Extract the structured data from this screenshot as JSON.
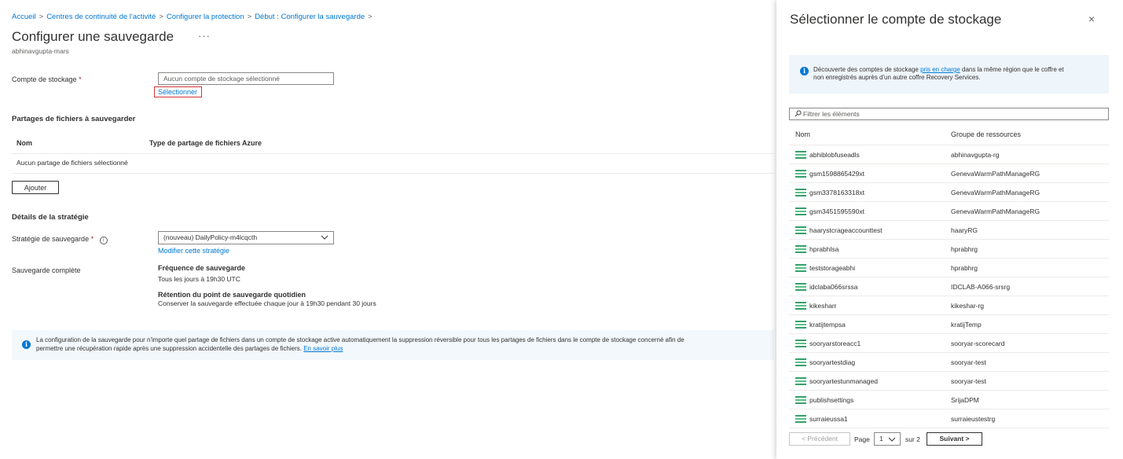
{
  "breadcrumb": {
    "items": [
      "Accueil",
      "Centres de continuité de l'activité",
      "Configurer la protection",
      "Début : Configurer la sauvegarde"
    ],
    "separator": ">"
  },
  "page": {
    "title": "Configurer une sauvegarde",
    "more": "···",
    "subtitle": "abhinavgupta-mars"
  },
  "storage": {
    "label": "Compte de stockage",
    "required": "*",
    "value": "Aucun compte de stockage sélectionné",
    "select_link": "Sélectionner"
  },
  "shares": {
    "heading": "Partages de fichiers à sauvegarder",
    "col_name": "Nom",
    "col_type": "Type de partage de fichiers Azure",
    "empty": "Aucun partage de fichiers sélectionné",
    "add_button": "Ajouter"
  },
  "policy": {
    "heading": "Détails de la stratégie",
    "label": "Stratégie de sauvegarde",
    "required": "*",
    "info": "i",
    "selected": "(nouveau) DailyPolicy-m4lcqcth",
    "edit_link": "Modifier cette stratégie",
    "full_label": "Sauvegarde complète",
    "freq_title": "Fréquence de sauvegarde",
    "freq_value": "Tous les jours à 19h30 UTC",
    "retention_title": "Rétention du point de sauvegarde quotidien",
    "retention_value": "Conserver la sauvegarde effectuée chaque jour à 19h30 pendant 30 jours"
  },
  "banner": {
    "line1": "La configuration de la sauvegarde pour n'importe quel partage de fichiers dans un compte de stockage active automatiquement la suppression réversible pour tous les partages de fichiers dans le compte de stockage concerné afin de",
    "line2": "permettre une récupération rapide après une suppression accidentelle des partages de fichiers.",
    "link": "En savoir plus"
  },
  "blade": {
    "title": "Sélectionner le compte de stockage",
    "close": "×",
    "info_pre": "Découverte des comptes de stockage ",
    "info_link": "pris en charge",
    "info_post": " dans la même région que le coffre et",
    "info_line2": "non enregistrés auprès d'un autre coffre Recovery Services.",
    "filter_placeholder": "Filtrer les éléments",
    "col_name": "Nom",
    "col_rg": "Groupe de ressources",
    "rows": [
      {
        "name": "abhiblobfuseadls",
        "rg": "abhinavgupta-rg"
      },
      {
        "name": "gsm1598865429xt",
        "rg": "GenevaWarmPathManageRG"
      },
      {
        "name": "gsm3378163318xt",
        "rg": "GenevaWarmPathManageRG"
      },
      {
        "name": "gsm3451595590xt",
        "rg": "GenevaWarmPathManageRG"
      },
      {
        "name": "haarystcrageaccounttest",
        "rg": "haaryRG"
      },
      {
        "name": "hprabhlsa",
        "rg": "hprabhrg"
      },
      {
        "name": "teststorageabhi",
        "rg": "hprabhrg"
      },
      {
        "name": "idclaba066srssa",
        "rg": "IDCLAB-A066-srsrg"
      },
      {
        "name": "kikesharr",
        "rg": "kikeshar-rg"
      },
      {
        "name": "kratijtempsa",
        "rg": "kratijTemp"
      },
      {
        "name": "sooryarstoreacc1",
        "rg": "sooryar-scorecard"
      },
      {
        "name": "sooryartestdiag",
        "rg": "sooryar-test"
      },
      {
        "name": "sooryartestunmanaged",
        "rg": "sooryar-test"
      },
      {
        "name": "publishsettings",
        "rg": "SrijaDPM"
      },
      {
        "name": "surraieussa1",
        "rg": "surraieustestrg"
      }
    ],
    "pager": {
      "prev": "< Précédent",
      "page_label": "Page",
      "page_value": "1",
      "of": "sur 2",
      "next": "Suivant >"
    }
  },
  "colors": {
    "accent": "#0078d4",
    "highlight_box": "#d13438",
    "storage_icon": "#35a06a"
  }
}
